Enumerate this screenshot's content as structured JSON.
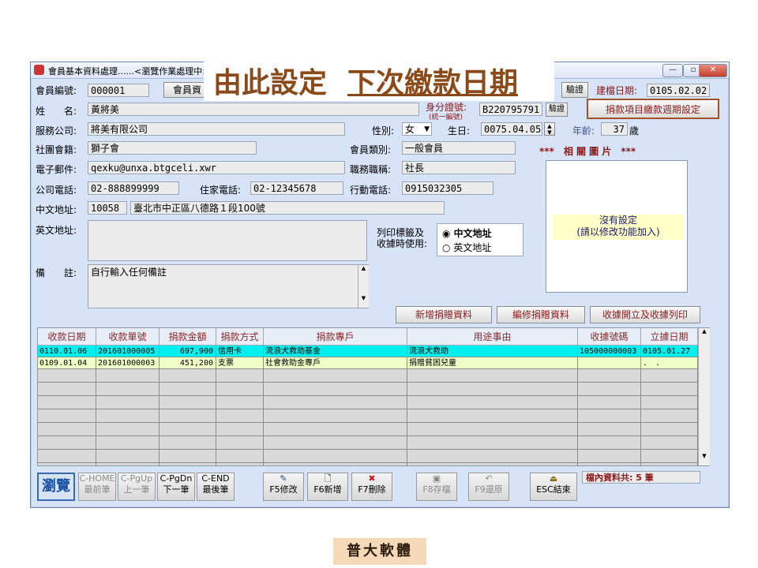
{
  "window": {
    "title": "會員基本資料處理......<瀏覽作業處理中>",
    "btn_min": "—",
    "btn_max": "▫",
    "btn_close": "✕"
  },
  "overlay": {
    "part1": "由此設定",
    "part2": "下次繳款日期"
  },
  "form": {
    "member_no_label": "會員編號:",
    "member_no": "000001",
    "member_info_label": "會員資",
    "verify_left_label": "驗證",
    "created_label": "建檔日期:",
    "created_value": "0105.02.02",
    "name_label": "姓　　名:",
    "name_value": "黃將美",
    "id_label": "身分證號:",
    "id_sub_label": "(統一編號)",
    "id_value": "B220795791",
    "verify_label": "驗證",
    "setup_button": "捐款項目繳款週期設定",
    "company_label": "服務公司:",
    "company_value": "將美有限公司",
    "gender_label": "性別:",
    "gender_value": "女",
    "birthday_label": "生日:",
    "birthday_value": "0075.04.05",
    "age_label": "年齡:",
    "age_value": "37",
    "age_unit": "歲",
    "club_label": "社團會籍:",
    "club_value": "獅子會",
    "member_type_label": "會員類別:",
    "member_type_value": "一般會員",
    "photo_header": "***　相 關 圖 片　***",
    "email_label": "電子郵件:",
    "email_value": "qexku@unxa.btgceli.xwr",
    "job_label": "職務職稱:",
    "job_value": "社長",
    "company_phone_label": "公司電話:",
    "company_phone_value": "02-888899999",
    "home_phone_label": "住家電話:",
    "home_phone_value": "02-12345678",
    "mobile_label": "行動電話:",
    "mobile_value": "0915032305",
    "cn_addr_label": "中文地址:",
    "cn_zip": "10058",
    "cn_addr": "臺北市中正區八德路１段100號",
    "en_addr_label": "英文地址:",
    "print_label_1": "列印標籤及",
    "print_label_2": "收據時使用:",
    "radio_cn": "中文地址",
    "radio_en": "英文地址",
    "photo_empty_1": "沒有設定",
    "photo_empty_2": "(請以修改功能加入)",
    "memo_label": "備　　註:",
    "memo_value": "自行輸入任何備註"
  },
  "actions": {
    "add_donation": "新增捐贈資料",
    "edit_donation": "編修捐贈資料",
    "receipt_print": "收據開立及收據列印"
  },
  "table": {
    "columns": [
      "收款日期",
      "收款單號",
      "捐款金額",
      "捐款方式",
      "捐款專戶",
      "用途事由",
      "收據號碼",
      "立據日期"
    ],
    "rows": [
      [
        "0110.01.06",
        "201601000005",
        "697,900",
        "信用卡",
        "流浪犬救助基金",
        "流浪犬救助",
        "105000000003",
        "0105.01.27"
      ],
      [
        "0109.01.04",
        "201601000003",
        "451,200",
        "支票",
        "社會救助金專戶",
        "捐贈貧困兒童",
        "",
        ".　."
      ]
    ]
  },
  "toolbar": {
    "browse": "瀏覽",
    "first_1": "C-HOME",
    "first_2": "最前筆",
    "prev_1": "C-PgUp",
    "prev_2": "上一筆",
    "next_1": "C-PgDn",
    "next_2": "下一筆",
    "last_1": "C-END",
    "last_2": "最後筆",
    "f5": "F5修改",
    "f6": "F6新增",
    "f7": "F7刪除",
    "f8": "F8存檔",
    "f9": "F9還原",
    "esc": "ESC結束",
    "count_label": "檔內資料共:",
    "count_value": "5",
    "count_unit": "筆"
  },
  "footer": {
    "brand": "普大軟體"
  }
}
